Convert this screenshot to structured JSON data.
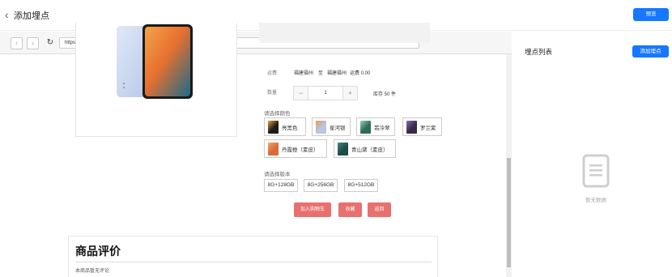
{
  "header": {
    "title": "添加埋点",
    "preview_label": "预览"
  },
  "browser": {
    "url": "https://dtm-beta.hwcloudtest.cn/dtmwebfour/dist/index.html#/goods/6096094"
  },
  "product": {
    "shipping_label": "运费",
    "ship_from": "福建福州",
    "ship_to_word": "至",
    "ship_to": "福建福州",
    "fee": "运费 0.00",
    "quantity_label": "数量",
    "quantity_value": "1",
    "stock": "库存 50 件",
    "color_label": "请选择颜色",
    "colors": [
      {
        "name": "亮黑色",
        "color": "#1c1c1c",
        "accent": "#e8a23a"
      },
      {
        "name": "星河银",
        "color": "#b9c7e0",
        "accent": "#e59a5a"
      },
      {
        "name": "翡冷翠",
        "color": "#2f6b5a",
        "accent": "#9ad0b5"
      },
      {
        "name": "罗兰紫",
        "color": "#3a2a4a",
        "accent": "#8b6fb2"
      },
      {
        "name": "丹霞橙（素皮）",
        "color": "#d96b3b",
        "accent": "#f1a36c"
      },
      {
        "name": "青山黛（素皮）",
        "color": "#1f4c48",
        "accent": "#3d8b7d"
      }
    ],
    "version_label": "请选择版本",
    "versions": [
      "8G+128GB",
      "8G+256GB",
      "8G+512GB"
    ],
    "buttons": {
      "add_cart": "加入购物车",
      "favorite": "收藏",
      "back": "返回"
    }
  },
  "review": {
    "title": "商品评价",
    "empty_note": "本商品暂无评论"
  },
  "right_panel": {
    "title": "埋点列表",
    "add_label": "添加埋点",
    "empty_text": "暂无数据"
  },
  "colors": {
    "primary": "#1677ff",
    "action_red": "#e8706e"
  }
}
